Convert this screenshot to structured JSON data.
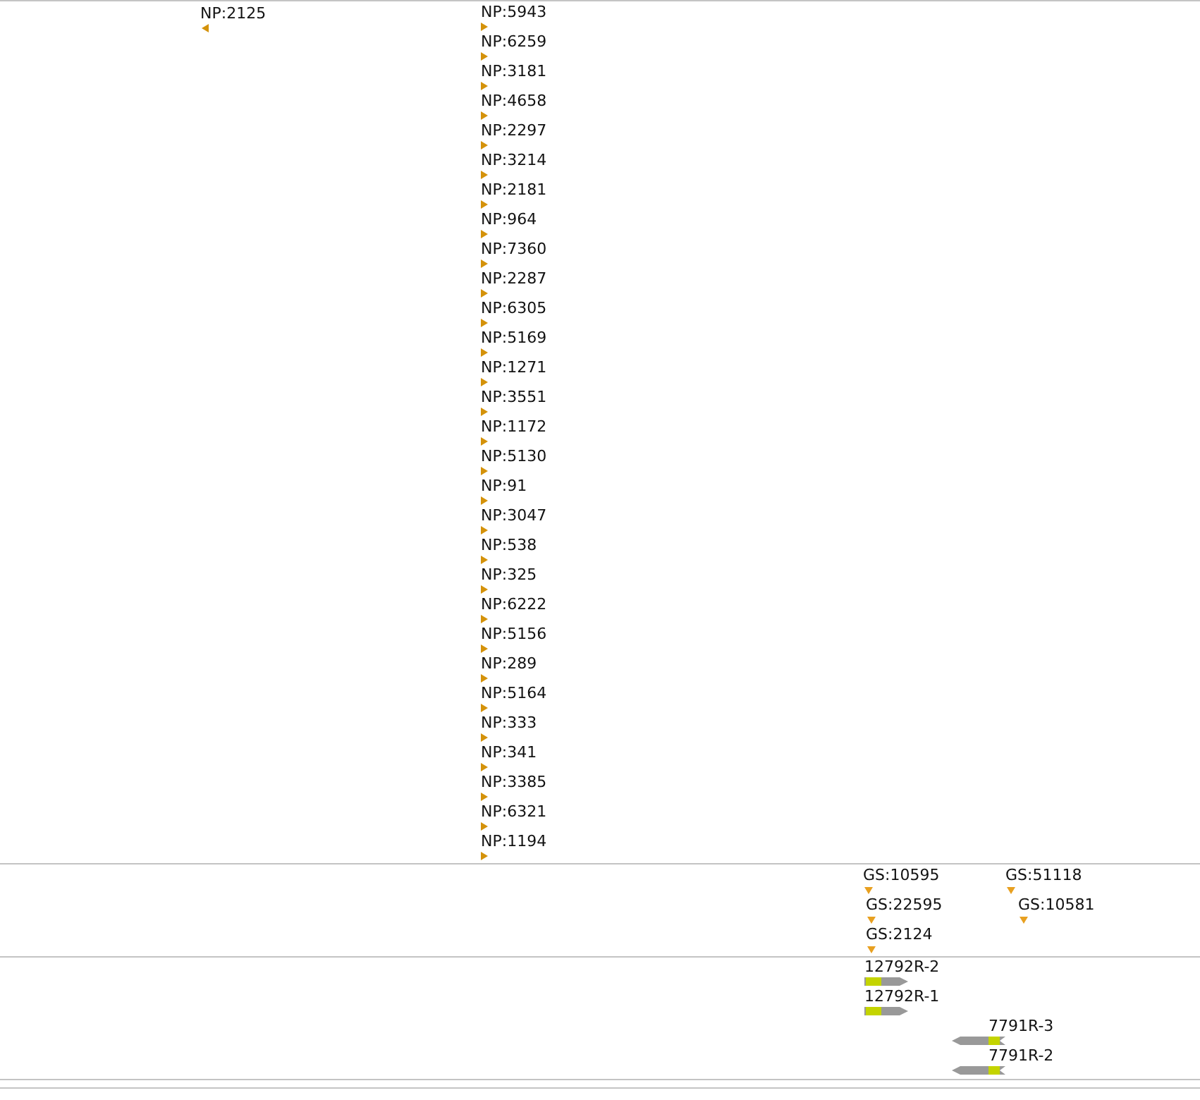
{
  "tracks": [
    {
      "features": [
        {
          "label": "NP:2125",
          "kind": "reverse"
        },
        {
          "label": "NP:5943",
          "kind": "forward"
        },
        {
          "label": "NP:6259",
          "kind": "forward"
        },
        {
          "label": "NP:3181",
          "kind": "forward"
        },
        {
          "label": "NP:4658",
          "kind": "forward"
        },
        {
          "label": "NP:2297",
          "kind": "forward"
        },
        {
          "label": "NP:3214",
          "kind": "forward"
        },
        {
          "label": "NP:2181",
          "kind": "forward"
        },
        {
          "label": "NP:964",
          "kind": "forward"
        },
        {
          "label": "NP:7360",
          "kind": "forward"
        },
        {
          "label": "NP:2287",
          "kind": "forward"
        },
        {
          "label": "NP:6305",
          "kind": "forward"
        },
        {
          "label": "NP:5169",
          "kind": "forward"
        },
        {
          "label": "NP:1271",
          "kind": "forward"
        },
        {
          "label": "NP:3551",
          "kind": "forward"
        },
        {
          "label": "NP:1172",
          "kind": "forward"
        },
        {
          "label": "NP:5130",
          "kind": "forward"
        },
        {
          "label": "NP:91",
          "kind": "forward"
        },
        {
          "label": "NP:3047",
          "kind": "forward"
        },
        {
          "label": "NP:538",
          "kind": "forward"
        },
        {
          "label": "NP:325",
          "kind": "forward"
        },
        {
          "label": "NP:6222",
          "kind": "forward"
        },
        {
          "label": "NP:5156",
          "kind": "forward"
        },
        {
          "label": "NP:289",
          "kind": "forward"
        },
        {
          "label": "NP:5164",
          "kind": "forward"
        },
        {
          "label": "NP:333",
          "kind": "forward"
        },
        {
          "label": "NP:341",
          "kind": "forward"
        },
        {
          "label": "NP:3385",
          "kind": "forward"
        },
        {
          "label": "NP:6321",
          "kind": "forward"
        },
        {
          "label": "NP:1194",
          "kind": "forward"
        }
      ]
    },
    {
      "features": [
        {
          "label": "GS:10595",
          "kind": "site"
        },
        {
          "label": "GS:22595",
          "kind": "site"
        },
        {
          "label": "GS:2124",
          "kind": "site"
        },
        {
          "label": "GS:51118",
          "kind": "site"
        },
        {
          "label": "GS:10581",
          "kind": "site"
        }
      ]
    },
    {
      "features": [
        {
          "label": "12792R-2",
          "kind": "transcript-forward"
        },
        {
          "label": "12792R-1",
          "kind": "transcript-forward"
        },
        {
          "label": "7791R-3",
          "kind": "transcript-reverse"
        },
        {
          "label": "7791R-2",
          "kind": "transcript-reverse"
        }
      ]
    }
  ]
}
